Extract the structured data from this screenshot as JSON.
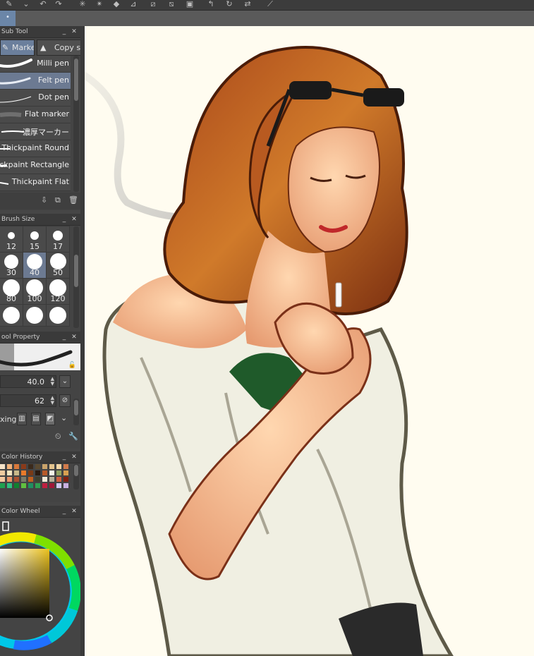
{
  "sub_tool": {
    "title": "Sub Tool",
    "tabs": [
      "Marker",
      "Copy st"
    ],
    "brushes": [
      {
        "label": "Milli pen",
        "selected": false
      },
      {
        "label": "Felt pen",
        "selected": true
      },
      {
        "label": "Dot pen",
        "selected": false
      },
      {
        "label": "Flat marker",
        "selected": false
      },
      {
        "label": "濃厚マーカー",
        "selected": false
      },
      {
        "label": "Thickpaint Round",
        "selected": false
      },
      {
        "label": "Thickpaint Rectangle",
        "selected": false
      },
      {
        "label": "Thickpaint Flat",
        "selected": false
      }
    ]
  },
  "brush_size": {
    "title": "Brush Size",
    "sizes": [
      "12",
      "15",
      "17",
      "30",
      "40",
      "50",
      "80",
      "100",
      "120"
    ],
    "selected": "40"
  },
  "tool_property": {
    "title": "ool Property",
    "size_value": "40.0",
    "opacity_value": "62",
    "mixing_label": "xing"
  },
  "color_history": {
    "title": "Color History",
    "swatches": [
      "#f5e3c8",
      "#f2b37a",
      "#d9783a",
      "#8a3a1a",
      "#3b2a1c",
      "#5a4a32",
      "#c9a36a",
      "#e4c48e",
      "#f4d6a6",
      "#d07a4a",
      "#f0cba0",
      "#f7e5c0",
      "#c8b88a",
      "#e87a2a",
      "#7a3a16",
      "#2a1a10",
      "#b85a2a",
      "#f5f5e8",
      "#90a060",
      "#d8a050",
      "#f4c8a0",
      "#e8956a",
      "#a85030",
      "#7a7a6a",
      "#c06020",
      "#404030",
      "#f2ead8",
      "#b8b098",
      "#d06040",
      "#802010",
      "#20a050",
      "#30c080",
      "#108030",
      "#60c040",
      "#209060",
      "#30a050",
      "#c02040",
      "#a01838",
      "#d0c8f0",
      "#c8b0e0"
    ]
  },
  "color_wheel": {
    "title": "Color Wheel",
    "main_color": "#ecc21c"
  },
  "colors": {
    "accent": "#6c7a92",
    "canvas": "#fffcf0"
  }
}
